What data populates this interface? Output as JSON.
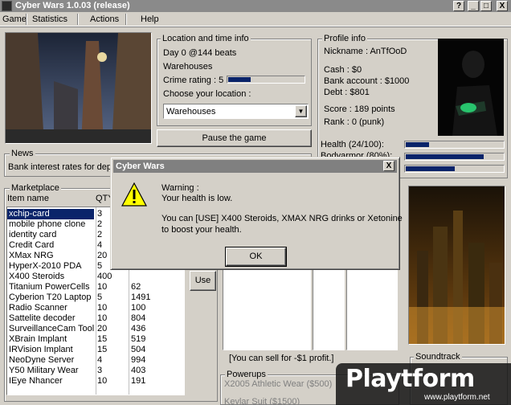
{
  "window": {
    "title": "Cyber Wars 1.0.03 (release)",
    "buttons": [
      "?",
      "_",
      "□",
      "X"
    ]
  },
  "menu": {
    "items": [
      "Game",
      "Statistics",
      "Actions",
      "Help"
    ]
  },
  "location": {
    "group_label": "Location and time info",
    "day_line": "Day 0 @144 beats",
    "current_place": "Warehouses",
    "crime_rating_label": "Crime rating : 5",
    "crime_rating_fraction": 0.3,
    "choose_label": "Choose your location :",
    "selected_location": "Warehouses",
    "pause_button": "Pause the game"
  },
  "profile": {
    "group_label": "Profile info",
    "nickname": "Nickname : AnTfOoD",
    "cash": "Cash : $0",
    "bank": "Bank account : $1000",
    "debt": "Debt : $801",
    "score": "Score : 189 points",
    "rank": "Rank : 0 (punk)",
    "health_label": "Health (24/100):",
    "health_fraction": 0.24,
    "partial_label": "Bodyarmor (80%):",
    "bar2_fraction": 0.8,
    "bar3_fraction": 0.5
  },
  "news": {
    "group_label": "News",
    "text": "Bank interest rates for dep"
  },
  "market": {
    "group_label": "Marketplace",
    "col_item": "Item name",
    "col_qty": "QTY",
    "use_button": "Use",
    "items": [
      {
        "name": "xchip-card",
        "qty": "3",
        "price": ""
      },
      {
        "name": "mobile phone clone",
        "qty": "2",
        "price": ""
      },
      {
        "name": "identity card",
        "qty": "2",
        "price": ""
      },
      {
        "name": "Credit Card",
        "qty": "4",
        "price": ""
      },
      {
        "name": "XMax NRG",
        "qty": "20",
        "price": ""
      },
      {
        "name": "HyperX-2010 PDA",
        "qty": "5",
        "price": ""
      },
      {
        "name": "X400 Steroids",
        "qty": "400",
        "price": ""
      },
      {
        "name": "Titanium PowerCells",
        "qty": "10",
        "price": "62"
      },
      {
        "name": "Cyberion T20 Laptop",
        "qty": "5",
        "price": "1491"
      },
      {
        "name": "Radio Scanner",
        "qty": "10",
        "price": "100"
      },
      {
        "name": "Sattelite decoder",
        "qty": "10",
        "price": "804"
      },
      {
        "name": "SurveillanceCam Tool",
        "qty": "20",
        "price": "436"
      },
      {
        "name": "XBrain Implant",
        "qty": "15",
        "price": "519"
      },
      {
        "name": "IRVision Implant",
        "qty": "15",
        "price": "504"
      },
      {
        "name": "NeoDyne Server",
        "qty": "4",
        "price": "994"
      },
      {
        "name": "Y50 Military Wear",
        "qty": "3",
        "price": "403"
      },
      {
        "name": "IEye Nhancer",
        "qty": "10",
        "price": "191"
      }
    ]
  },
  "sell_info": "[You can sell for -$1 profit.]",
  "powerups": {
    "group_label": "Powerups",
    "items": [
      "X2005 Athletic Wear ($500)",
      "Kevlar Suit ($1500)"
    ]
  },
  "soundtrack": {
    "group_label": "Soundtrack"
  },
  "dialog": {
    "title": "Cyber Wars",
    "close": "X",
    "warning_title": "Warning :",
    "line1": "Your health is low.",
    "line2": "You can [USE] X400 Steroids, XMAX NRG drinks or Xetonine",
    "line3": "to boost your health.",
    "ok": "OK"
  },
  "watermark": {
    "brand": "Playtform",
    "url": "www.playtform.net"
  }
}
